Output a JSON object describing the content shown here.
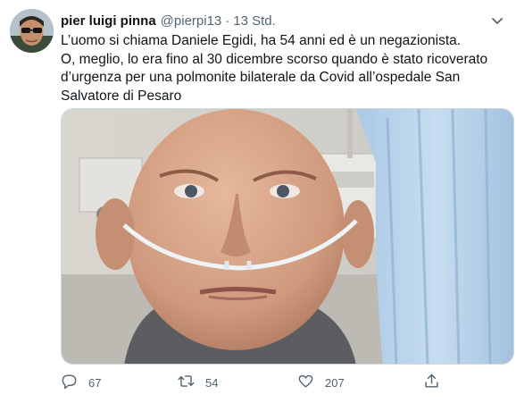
{
  "tweet": {
    "author_name": "pier luigi pinna",
    "handle": "@pierpi13",
    "separator": "·",
    "time": "13 Std.",
    "text_lines": [
      "L’uomo si chiama Daniele Egidi, ha 54 anni ed è un negazionista.",
      "O, meglio, lo era fino al 30 dicembre scorso quando è stato ricoverato",
      "d’urgenza per una polmonite bilaterale da Covid all’ospedale San",
      "Salvatore di Pesaro"
    ]
  },
  "actions": {
    "reply_count": "67",
    "retweet_count": "54",
    "like_count": "207"
  },
  "icons": {
    "more": "more-icon",
    "reply": "reply-icon",
    "retweet": "retweet-icon",
    "like": "like-icon",
    "share": "share-icon"
  },
  "colors": {
    "text": "#0f1419",
    "secondary": "#536471",
    "border": "#cfd9de"
  }
}
